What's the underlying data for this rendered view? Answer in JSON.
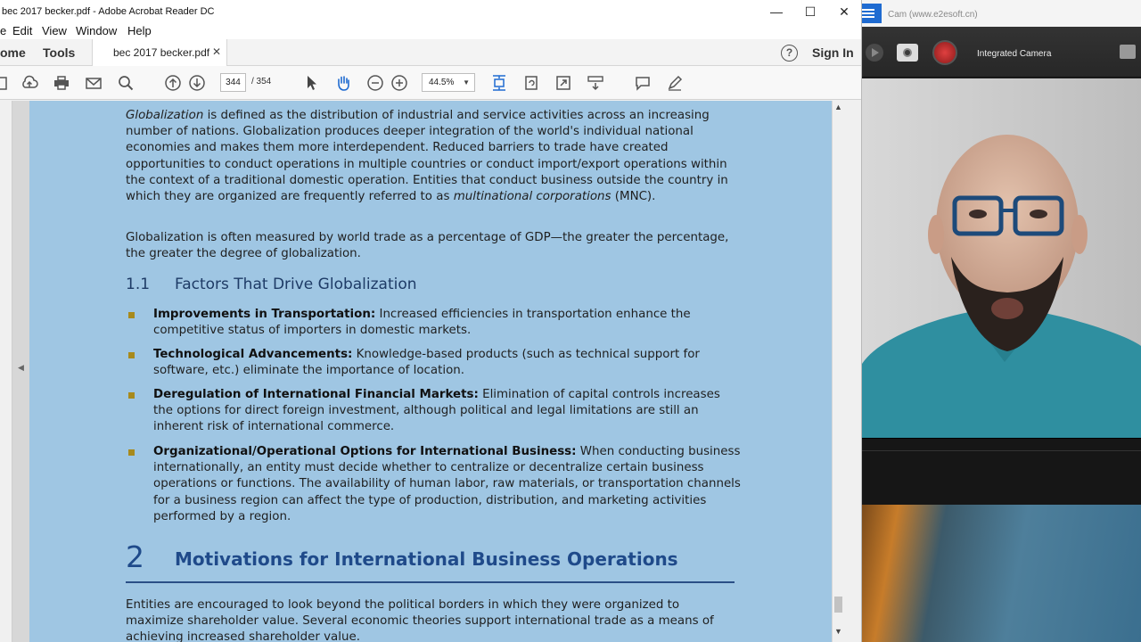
{
  "window": {
    "title": "bec 2017 becker.pdf - Adobe Acrobat Reader DC",
    "minimize": "—",
    "maximize": "☐",
    "close": "✕"
  },
  "menu": {
    "file": "e",
    "edit": "Edit",
    "view": "View",
    "window": "Window",
    "help": "Help"
  },
  "tabs": {
    "home": "ome",
    "tools": "Tools",
    "document": "bec 2017 becker.pdf",
    "close": "✕",
    "help": "?",
    "sign_in": "Sign In"
  },
  "toolbar": {
    "current_page": "344",
    "page_total": "/  354",
    "zoom": "44.5%",
    "zoom_caret": "▼"
  },
  "pdf": {
    "para1_term": "Globalization",
    "para1_a": " is defined as the distribution of industrial and service activities across an increasing number of nations. Globalization produces deeper integration of the world's individual national economies and makes them more interdependent. Reduced barriers to trade have created opportunities to conduct operations in multiple countries or conduct import/export operations within the context of a traditional domestic operation. Entities that conduct business outside the country in which they are organized are frequently referred to as ",
    "para1_term2": "multinational corporations",
    "para1_b": " (MNC).",
    "para2": "Globalization is often measured by world trade as a percentage of GDP—the greater the percentage, the greater the degree of globalization.",
    "section_number": "1.1",
    "section_title": "Factors That Drive Globalization",
    "bullets": [
      {
        "title": "Improvements in Transportation:",
        "text": " Increased efficiencies in transportation enhance the competitive status of importers in domestic markets."
      },
      {
        "title": "Technological Advancements:",
        "text": " Knowledge-based products (such as technical support for software, etc.) eliminate the importance of location."
      },
      {
        "title": "Deregulation of International Financial Markets:",
        "text": " Elimination of capital controls increases the options for direct foreign investment, although political and legal limitations are still an inherent risk of international commerce."
      },
      {
        "title": "Organizational/Operational Options for International Business:",
        "text": " When conducting business internationally, an entity must decide whether to centralize or decentralize certain business operations or functions. The availability of human labor, raw materials, or transportation channels for a business region can affect the type of production, distribution, and marketing activities performed by a region."
      }
    ],
    "chapter_number": "2",
    "chapter_title": "Motivations for International Business Operations",
    "para3": "Entities are encouraged to look beyond the political borders in which they were organized to maximize shareholder value. Several economic theories support international trade as a means of achieving increased shareholder value."
  },
  "webcam": {
    "title": "Cam (www.e2esoft.cn)",
    "device": "Integrated Camera"
  },
  "colors": {
    "page_bg": "#9fc6e3",
    "heading": "#1e3b66",
    "chapter_heading": "#1f4a8a",
    "bullet": "#a88a1c",
    "cam_menu": "#1f6bd1",
    "record": "#e04040"
  }
}
